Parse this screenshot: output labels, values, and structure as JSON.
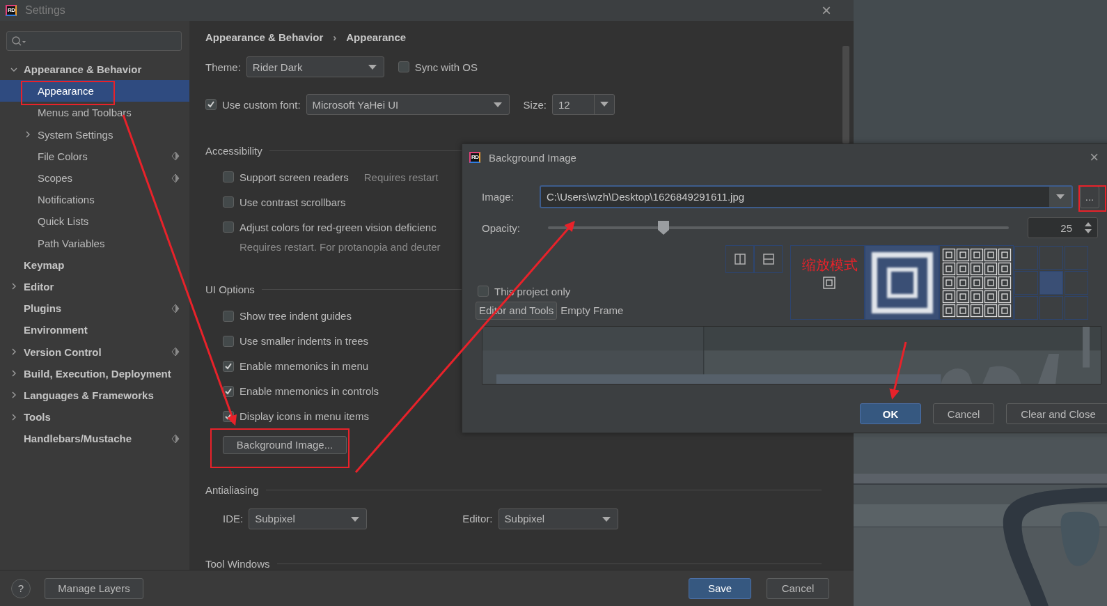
{
  "window": {
    "logo": "RD",
    "title": "Settings",
    "close": "×"
  },
  "sidebar": {
    "items": [
      {
        "label": "Appearance & Behavior",
        "expanded": true,
        "selected": false,
        "shared": false,
        "children": [
          {
            "label": "Appearance",
            "selected": true,
            "shared": false
          },
          {
            "label": "Menus and Toolbars",
            "selected": false,
            "shared": false
          },
          {
            "label": "System Settings",
            "expanded": false,
            "selected": false,
            "shared": false
          },
          {
            "label": "File Colors",
            "selected": false,
            "shared": true
          },
          {
            "label": "Scopes",
            "selected": false,
            "shared": true
          },
          {
            "label": "Notifications",
            "selected": false,
            "shared": false
          },
          {
            "label": "Quick Lists",
            "selected": false,
            "shared": false
          },
          {
            "label": "Path Variables",
            "selected": false,
            "shared": false
          }
        ]
      },
      {
        "label": "Keymap",
        "selected": false,
        "shared": false
      },
      {
        "label": "Editor",
        "expanded": false,
        "selected": false,
        "shared": false
      },
      {
        "label": "Plugins",
        "selected": false,
        "shared": true
      },
      {
        "label": "Environment",
        "selected": false,
        "shared": false
      },
      {
        "label": "Version Control",
        "expanded": false,
        "selected": false,
        "shared": true
      },
      {
        "label": "Build, Execution, Deployment",
        "expanded": false,
        "selected": false,
        "shared": false
      },
      {
        "label": "Languages & Frameworks",
        "expanded": false,
        "selected": false,
        "shared": false
      },
      {
        "label": "Tools",
        "expanded": false,
        "selected": false,
        "shared": false
      },
      {
        "label": "Handlebars/Mustache",
        "selected": false,
        "shared": true
      }
    ]
  },
  "breadcrumb": {
    "items": [
      "Appearance & Behavior",
      "Appearance"
    ],
    "separator": "›"
  },
  "theme": {
    "label": "Theme:",
    "value": "Rider Dark"
  },
  "sync_with_os": {
    "label": "Sync with OS",
    "checked": false
  },
  "custom_font": {
    "label": "Use custom font:",
    "checked": true,
    "value": "Microsoft YaHei UI"
  },
  "size": {
    "label": "Size:",
    "value": "12"
  },
  "accessibility": {
    "title": "Accessibility",
    "options": [
      {
        "label": "Support screen readers",
        "checked": false,
        "note": "Requires restart"
      },
      {
        "label": "Use contrast scrollbars",
        "checked": false
      },
      {
        "label": "Adjust colors for red-green vision deficienc",
        "checked": false,
        "hint": "Requires restart. For protanopia and deuter"
      }
    ]
  },
  "ui_options": {
    "title": "UI Options",
    "options": [
      {
        "label": "Show tree indent guides",
        "checked": false
      },
      {
        "label": "Use smaller indents in trees",
        "checked": false
      },
      {
        "label": "Enable mnemonics in menu",
        "checked": true
      },
      {
        "label": "Enable mnemonics in controls",
        "checked": true
      },
      {
        "label": "Display icons in menu items",
        "checked": true
      }
    ],
    "button": "Background Image..."
  },
  "antialiasing": {
    "title": "Antialiasing",
    "ide": {
      "label": "IDE:",
      "value": "Subpixel"
    },
    "editor": {
      "label": "Editor:",
      "value": "Subpixel"
    }
  },
  "tool_windows": {
    "title": "Tool Windows"
  },
  "footer": {
    "help": "?",
    "manage": "Manage Layers",
    "save": "Save",
    "cancel": "Cancel"
  },
  "dialog": {
    "logo": "RD",
    "title": "Background Image",
    "close": "×",
    "image": {
      "label": "Image:",
      "value": "C:\\Users\\wzh\\Desktop\\1626849291611.jpg"
    },
    "browse": "...",
    "opacity": {
      "label": "Opacity:",
      "level": 0.25,
      "value": "25"
    },
    "flips": [
      {
        "kind": "vertical",
        "selected": false
      },
      {
        "kind": "horizontal",
        "selected": false
      }
    ],
    "fill_modes": [
      {
        "kind": "scale",
        "selected": false
      },
      {
        "kind": "stretch",
        "selected": true
      },
      {
        "kind": "tile",
        "selected": false
      },
      {
        "kind": "anchor",
        "selected": false
      }
    ],
    "anchors": [
      {
        "selected": false
      },
      {
        "selected": false
      },
      {
        "selected": false
      },
      {
        "selected": false
      },
      {
        "selected": true
      },
      {
        "selected": false
      },
      {
        "selected": false
      },
      {
        "selected": false
      },
      {
        "selected": false
      }
    ],
    "annotation": "缩放模式",
    "this_project_only": {
      "label": "This project only",
      "checked": false
    },
    "targets": [
      {
        "label": "Editor and Tools",
        "selected": true
      },
      {
        "label": "Empty Frame",
        "selected": false
      }
    ],
    "buttons": [
      {
        "label": "OK",
        "default": true
      },
      {
        "label": "Cancel",
        "default": false
      },
      {
        "label": "Clear and Close",
        "default": false
      }
    ]
  }
}
